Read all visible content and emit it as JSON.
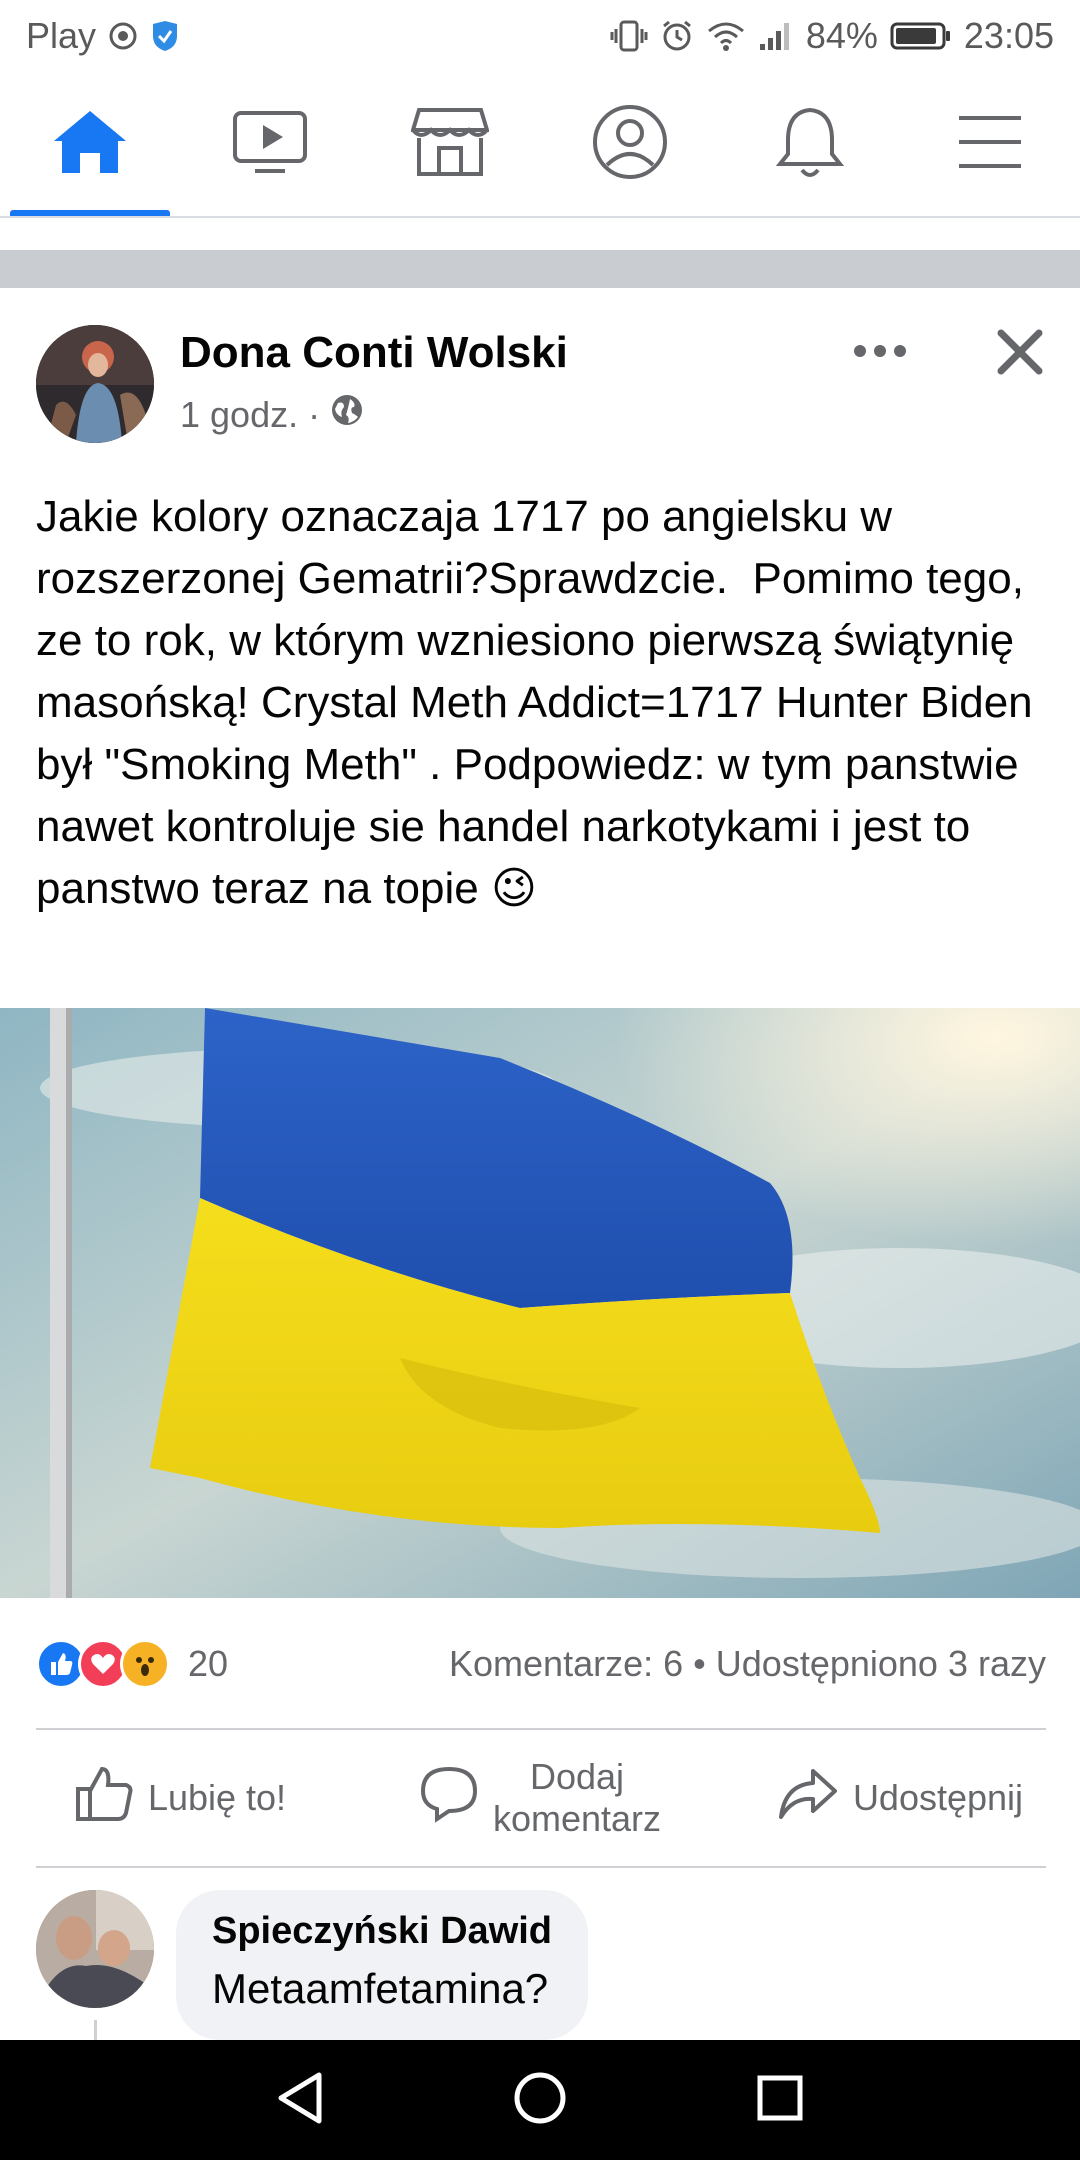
{
  "status_bar": {
    "carrier": "Play",
    "battery": "84%",
    "time": "23:05"
  },
  "nav": {
    "items": [
      "home-icon",
      "video-icon",
      "marketplace-icon",
      "profile-icon",
      "notifications-icon",
      "menu-icon"
    ],
    "active": "home",
    "accent": "#1877f2"
  },
  "post": {
    "author": "Dona Conti Wolski",
    "time": "1 godz.",
    "separator": "·",
    "audience_icon": "globe-icon",
    "text": "Jakie kolory oznaczaja 1717 po angielsku w rozszerzonej Gematrii?Sprawdzcie.  Pomimo tego, ze to rok, w którym wzniesiono pierwszą świątynię masońską! Crystal Meth Addict=1717 Hunter Biden był \"Smoking Meth\" . Podpowiedz: w tym panstwie nawet kontroluje sie handel narkotykami i jest to panstwo teraz na topie 😉",
    "image_alt": "ukraine-flag-image",
    "reactions_count": "20",
    "comments": "Komentarze: 6",
    "dot": "•",
    "shares": "Udostępniono 3 razy"
  },
  "actions": {
    "like": "Lubię to!",
    "comment_line1": "Dodaj",
    "comment_line2": "komentarz",
    "share": "Udostępnij"
  },
  "comment": {
    "author": "Spieczyński Dawid",
    "text": "Metaamfetamina?"
  }
}
